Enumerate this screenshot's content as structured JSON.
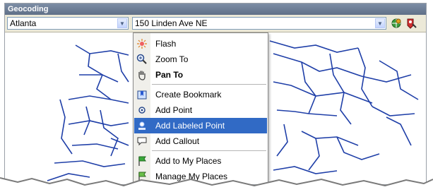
{
  "window": {
    "title": "Geocoding"
  },
  "toolbar": {
    "city": "Atlanta",
    "address": "150 Linden Ave NE",
    "dropdown_glyph": "▼",
    "icons": [
      "geocode-icon",
      "reverse-geocode-icon"
    ]
  },
  "menu": {
    "items": [
      {
        "label": "Flash",
        "icon": "flash-icon"
      },
      {
        "label": "Zoom To",
        "icon": "zoom-in-icon"
      },
      {
        "label": "Pan To",
        "icon": "pan-hand-icon",
        "bold": true
      },
      {
        "label": "Create Bookmark",
        "icon": "bookmark-icon"
      },
      {
        "label": "Add Point",
        "icon": "point-icon"
      },
      {
        "label": "Add Labeled Point",
        "icon": "labeled-point-icon",
        "selected": true
      },
      {
        "label": "Add Callout",
        "icon": "callout-icon"
      },
      {
        "label": "Add to My Places",
        "icon": "flag-icon"
      },
      {
        "label": "Manage My Places",
        "icon": "flag-manage-icon"
      }
    ]
  },
  "colors": {
    "road": "#1f3fa8",
    "selection": "#316ac5",
    "title_bar": "#6b7c94"
  }
}
